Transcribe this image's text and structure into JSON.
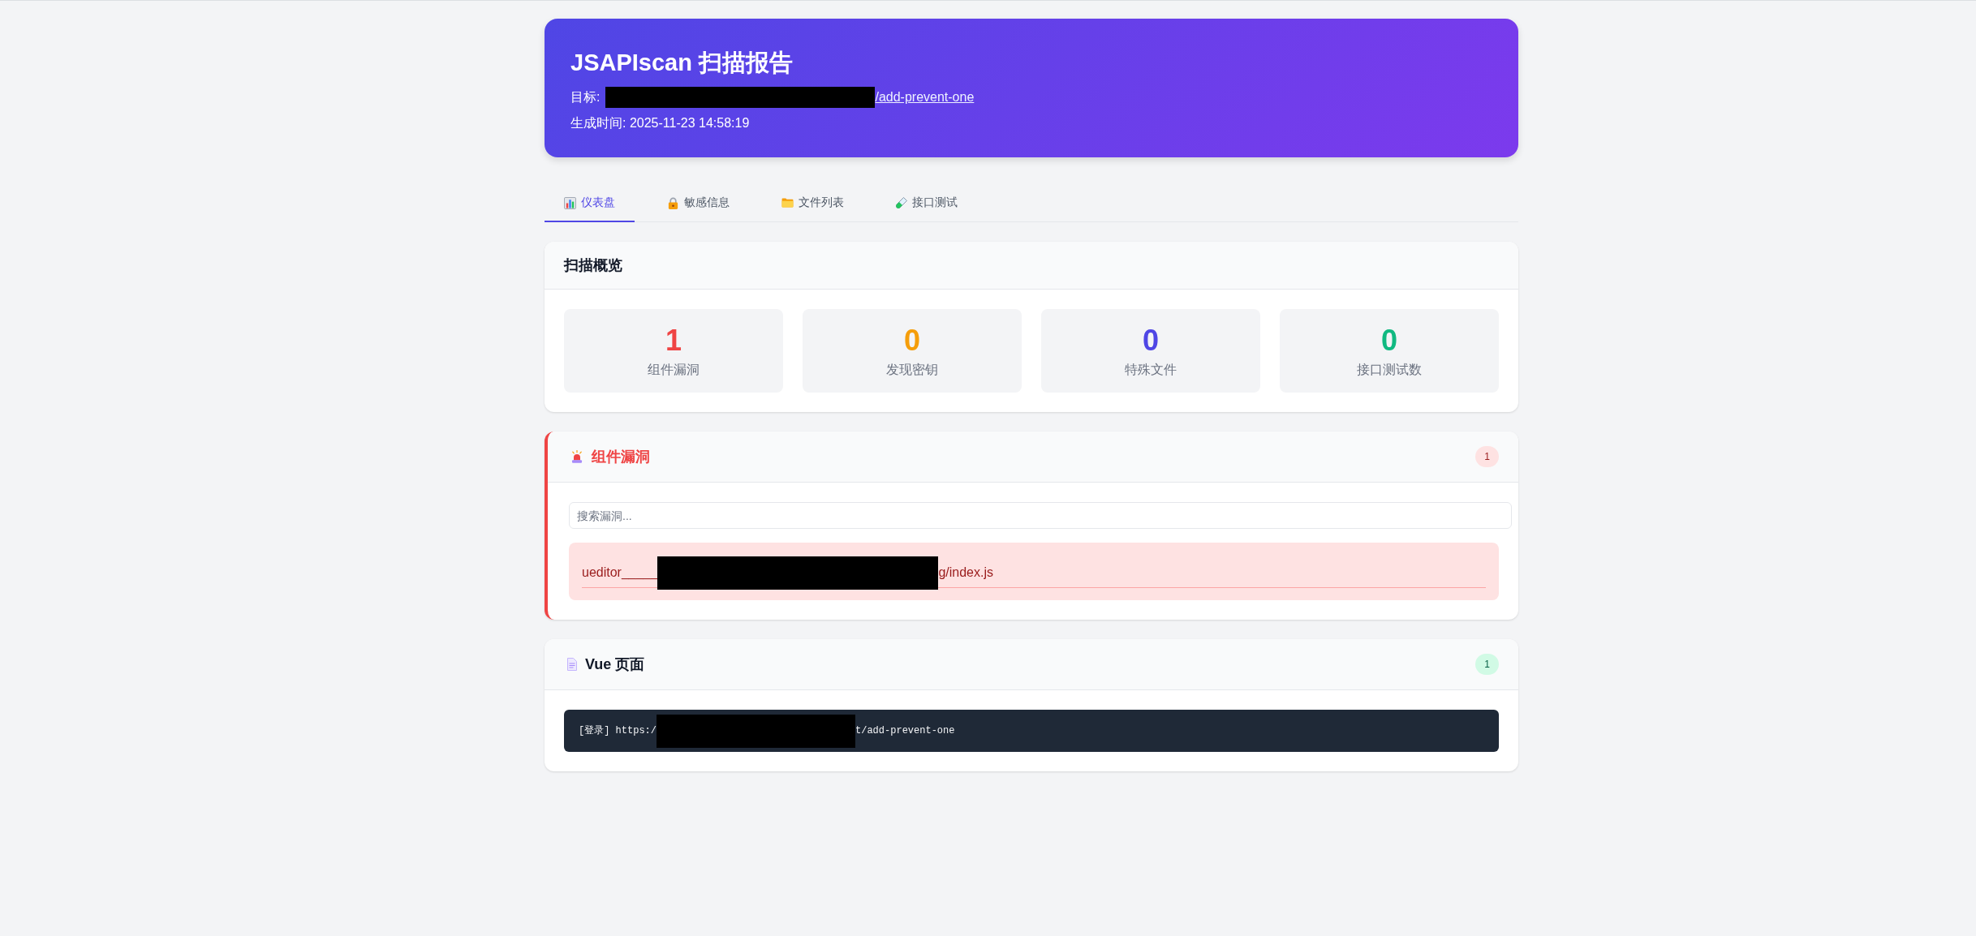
{
  "header": {
    "title": "JSAPIscan 扫描报告",
    "target": {
      "label": "目标:",
      "redacted": true,
      "link": "/add-prevent-one"
    },
    "generated": "生成时间: 2025-11-23 14:58:19"
  },
  "tabs": [
    {
      "label": "仪表盘",
      "selected": true
    },
    {
      "label": "敏感信息",
      "selected": false
    },
    {
      "label": "文件列表",
      "selected": false
    },
    {
      "label": "接口测试",
      "selected": false
    }
  ],
  "overview": {
    "title": "扫描概览",
    "stats": [
      {
        "value": "1",
        "label": "组件漏洞",
        "color": "#ef4444"
      },
      {
        "value": "0",
        "label": "发现密钥",
        "color": "#f59e0b"
      },
      {
        "value": "0",
        "label": "特殊文件",
        "color": "#4f46e5"
      },
      {
        "value": "0",
        "label": "接口测试数",
        "color": "#10b981"
      }
    ]
  },
  "sections": [
    {
      "kind": "vulnerabilities",
      "title": "组件漏洞",
      "count": "1",
      "search": {
        "placeholder": "搜索漏洞..."
      },
      "items": [
        {
          "text_before": "ueditor_____",
          "redacted": true,
          "text_after": "g/index.js"
        }
      ]
    },
    {
      "kind": "pages",
      "title": "Vue 页面",
      "count": "1",
      "items": [
        {
          "text_before": "[登录] https:/",
          "redacted": true,
          "text_after": "t/add-prevent-one"
        }
      ]
    }
  ]
}
